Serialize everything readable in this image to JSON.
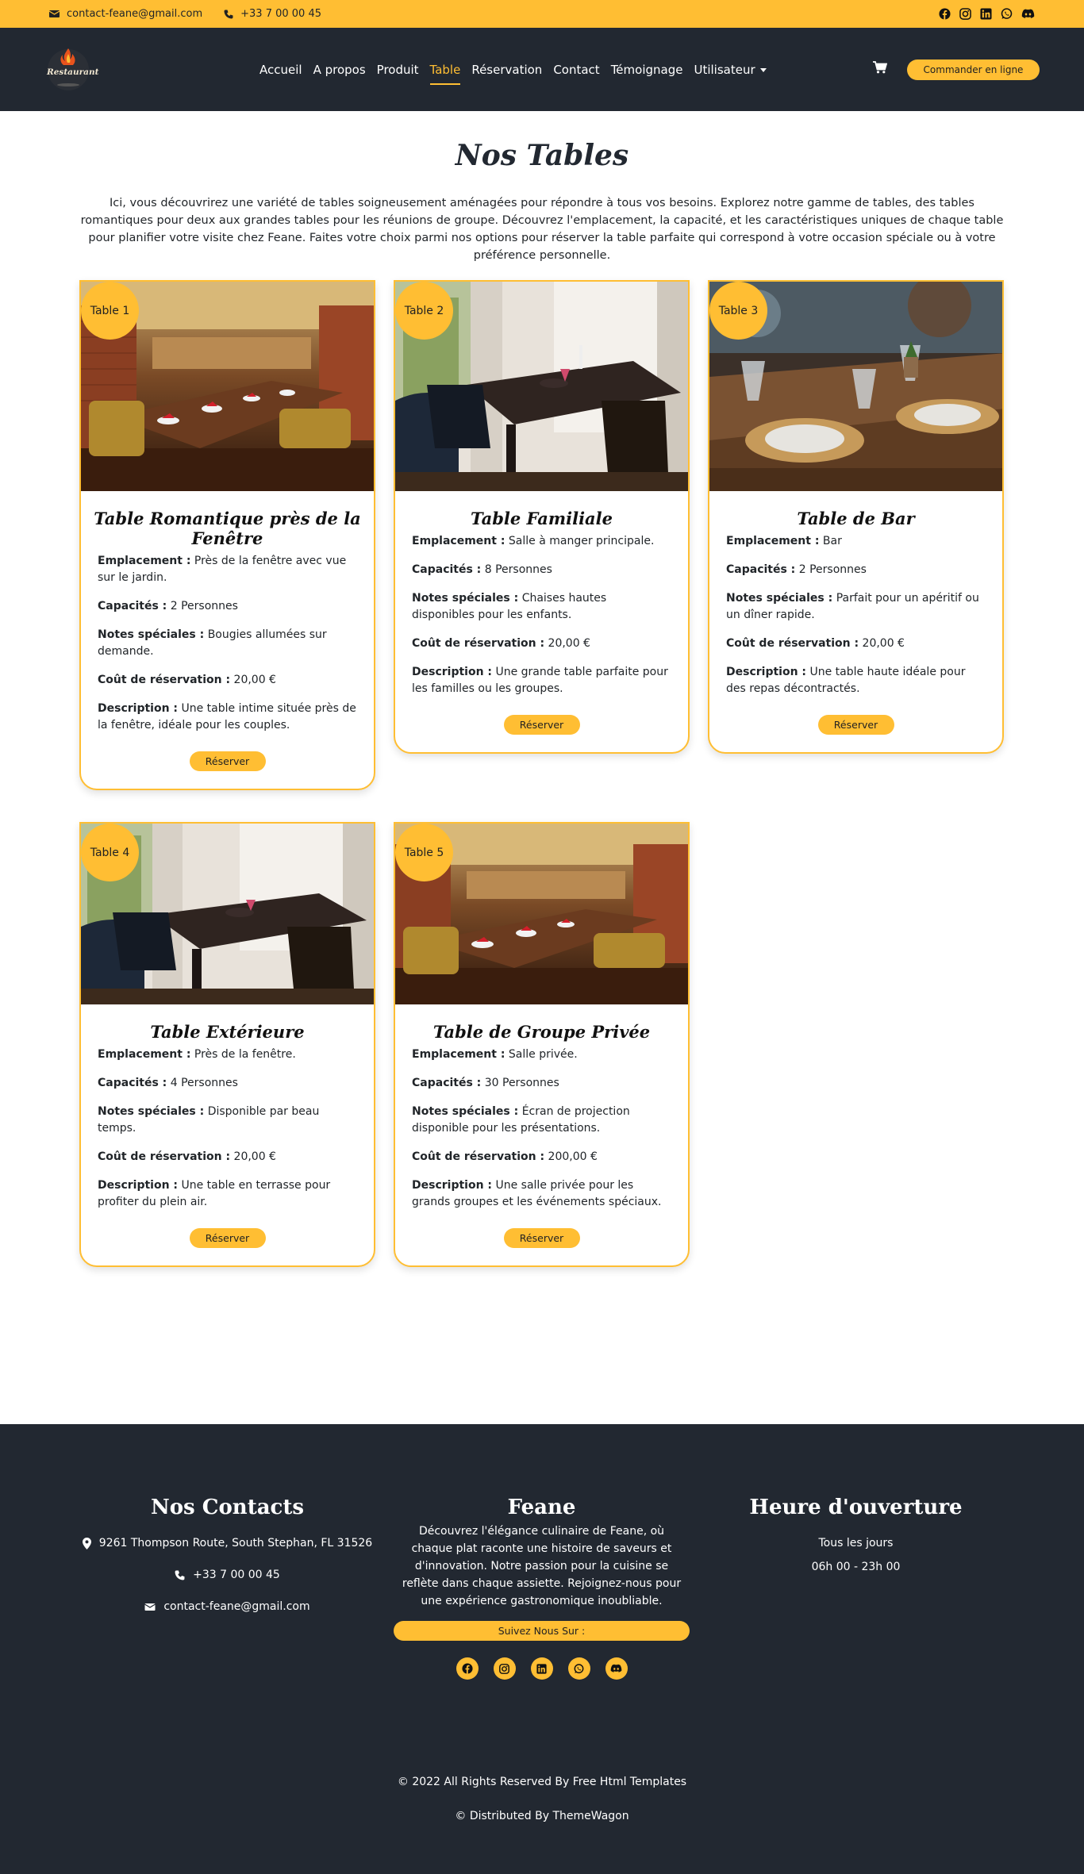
{
  "topbar": {
    "email": "contact-feane@gmail.com",
    "phone": "+33 7 00 00 45",
    "social": [
      "facebook-icon",
      "instagram-icon",
      "linkedin-icon",
      "whatsapp-icon",
      "discord-icon"
    ]
  },
  "nav": {
    "logo_text": "Restaurant",
    "items": [
      "Accueil",
      "A propos",
      "Produit",
      "Table",
      "Réservation",
      "Contact",
      "Témoignage",
      "Utilisateur"
    ],
    "active": "Table",
    "order_button": "Commander en ligne"
  },
  "page": {
    "title": "Nos Tables",
    "intro": "Ici, vous découvrirez une variété de tables soigneusement aménagées pour répondre à tous vos besoins. Explorez notre gamme de tables, des tables romantiques pour deux aux grandes tables pour les réunions de groupe. Découvrez l'emplacement, la capacité, et les caractéristiques uniques de chaque table pour planifier votre visite chez Feane. Faites votre choix parmi nos options pour réserver la table parfaite qui correspond à votre occasion spéciale ou à votre préférence personnelle."
  },
  "labels": {
    "location": "Emplacement :",
    "capacity": "Capacités :",
    "notes": "Notes spéciales :",
    "cost": "Coût de réservation :",
    "description": "Description :",
    "reserve": "Réserver"
  },
  "tables": [
    {
      "badge": "Table 1",
      "name": "Table Romantique près de la Fenêtre",
      "location": "Près de la fenêtre avec vue sur le jardin.",
      "capacity": "2 Personnes",
      "notes": "Bougies allumées sur demande.",
      "cost": "20,00 €",
      "description": "Une table intime située près de la fenêtre, idéale pour les couples."
    },
    {
      "badge": "Table 2",
      "name": "Table Familiale",
      "location": "Salle à manger principale.",
      "capacity": "8 Personnes",
      "notes": "Chaises hautes disponibles pour les enfants.",
      "cost": "20,00 €",
      "description": "Une grande table parfaite pour les familles ou les groupes."
    },
    {
      "badge": "Table 3",
      "name": "Table de Bar",
      "location": "Bar",
      "capacity": "2 Personnes",
      "notes": "Parfait pour un apéritif ou un dîner rapide.",
      "cost": "20,00 €",
      "description": "Une table haute idéale pour des repas décontractés."
    },
    {
      "badge": "Table 4",
      "name": "Table Extérieure",
      "location": "Près de la fenêtre.",
      "capacity": "4 Personnes",
      "notes": "Disponible par beau temps.",
      "cost": "20,00 €",
      "description": "Une table en terrasse pour profiter du plein air."
    },
    {
      "badge": "Table 5",
      "name": "Table de Groupe Privée",
      "location": "Salle privée.",
      "capacity": "30 Personnes",
      "notes": "Écran de projection disponible pour les présentations.",
      "cost": "200,00 €",
      "description": "Une salle privée pour les grands groupes et les événements spéciaux."
    }
  ],
  "footer": {
    "contacts_title": "Nos Contacts",
    "address": "9261 Thompson Route, South Stephan, FL 31526",
    "phone": "+33 7 00 00 45",
    "email": "contact-feane@gmail.com",
    "brand_title": "Feane",
    "brand_text": "Découvrez l'élégance culinaire de Feane, où chaque plat raconte une histoire de saveurs et d'innovation. Notre passion pour la cuisine se reflète dans chaque assiette. Rejoignez-nous pour une expérience gastronomique inoubliable.",
    "follow_label": "Suivez Nous Sur :",
    "hours_title": "Heure d'ouverture",
    "hours_days": "Tous les jours",
    "hours_time": "06h 00 - 23h 00",
    "copyright": "© 2022 All Rights Reserved By Free Html Templates",
    "distributed": "© Distributed By ThemeWagon"
  },
  "colors": {
    "accent": "#ffbe33",
    "dark": "#222831"
  }
}
